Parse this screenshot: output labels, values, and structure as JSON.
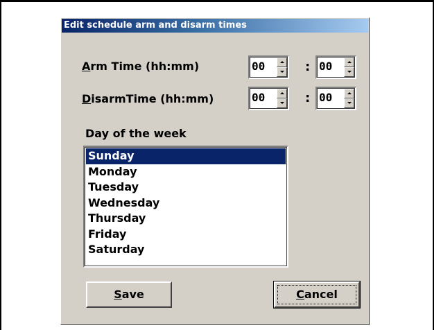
{
  "dialog": {
    "title": "Edit schedule arm and disarm times",
    "arm": {
      "label_mnemonic": "A",
      "label_rest": "rm Time (hh:mm)",
      "hours": "00",
      "minutes": "00"
    },
    "disarm": {
      "label_mnemonic": "D",
      "label_rest": "isarmTime (hh:mm)",
      "hours": "00",
      "minutes": "00"
    },
    "separator": ":",
    "day_label": "Day of the week",
    "days": [
      "Sunday",
      "Monday",
      "Tuesday",
      "Wednesday",
      "Thursday",
      "Friday",
      "Saturday"
    ],
    "selected_day": "Sunday",
    "save_mnemonic": "S",
    "save_rest": "ave",
    "cancel_mnemonic": "C",
    "cancel_rest": "ancel"
  },
  "colors": {
    "titlebar_start": "#0a246a",
    "titlebar_end": "#a6caf0",
    "dialog_bg": "#d4d0c8",
    "selection": "#0a246a"
  }
}
